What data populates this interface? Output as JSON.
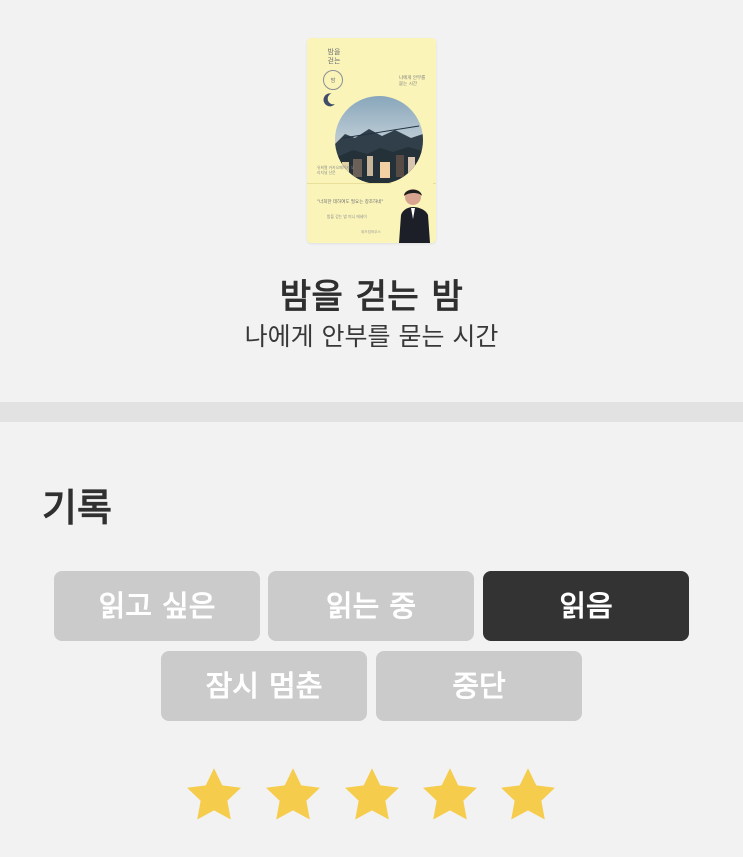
{
  "book": {
    "title": "밤을 걷는 밤",
    "subtitle": "나에게 안부를 묻는 시간",
    "cover": {
      "title_line1": "밤을",
      "title_line2": "걷는",
      "badge": "밤",
      "sub_text": "나에게 안부를 묻는 시간",
      "author_text": "유희열 카카오페이지 오리지널 산문",
      "quote": "\"너희한 데하여도 필요는 창조하네\"",
      "small_text": "밤을 걷는 밤 미니 에세이",
      "publisher": "위즈덤하우스"
    }
  },
  "record": {
    "title": "기록",
    "statuses": [
      {
        "label": "읽고 싶은",
        "selected": false
      },
      {
        "label": "읽는 중",
        "selected": false
      },
      {
        "label": "읽음",
        "selected": true
      },
      {
        "label": "잠시 멈춘",
        "selected": false
      },
      {
        "label": "중단",
        "selected": false
      }
    ],
    "rating": 5,
    "rating_max": 5,
    "star_color": "#f5cc4b"
  },
  "colors": {
    "background": "#f2f2f2",
    "divider": "#e2e2e2",
    "button": "#cbcbcb",
    "button_selected": "#333333",
    "text_primary": "#2f2f2f",
    "cover_background": "#fbf4b8"
  }
}
